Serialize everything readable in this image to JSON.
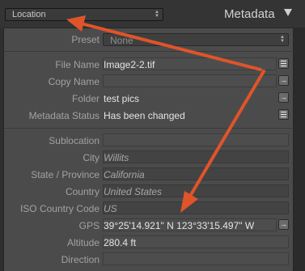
{
  "header": {
    "preset_selector": "Location",
    "title": "Metadata"
  },
  "preset_row": {
    "label": "Preset",
    "value": "None"
  },
  "file_fields": [
    {
      "name": "file-name",
      "label": "File Name",
      "value": "Image2-2.tif",
      "button_icon": "list-icon"
    },
    {
      "name": "copy-name",
      "label": "Copy Name",
      "value": "",
      "button_icon": "arrow-right-icon"
    },
    {
      "name": "folder",
      "label": "Folder",
      "value": "test pics",
      "button_icon": "arrow-right-icon"
    },
    {
      "name": "metadata-status",
      "label": "Metadata Status",
      "value": "Has been changed",
      "button_icon": "list-icon"
    }
  ],
  "location_fields": [
    {
      "name": "sublocation",
      "label": "Sublocation",
      "value": ""
    },
    {
      "name": "city",
      "label": "City",
      "value": "Willits"
    },
    {
      "name": "state-province",
      "label": "State / Province",
      "value": "California"
    },
    {
      "name": "country",
      "label": "Country",
      "value": "United States"
    },
    {
      "name": "iso-country-code",
      "label": "ISO Country Code",
      "value": "US"
    }
  ],
  "gps_fields": [
    {
      "name": "gps",
      "label": "GPS",
      "value": "39°25'14.921\" N 123°33'15.497\" W",
      "button_icon": "arrow-right-icon"
    },
    {
      "name": "altitude",
      "label": "Altitude",
      "value": "280.4 ft"
    },
    {
      "name": "direction",
      "label": "Direction",
      "value": ""
    }
  ],
  "colors": {
    "annotation_arrow": "#e0542a",
    "panel_bg": "#4b4b4b"
  }
}
